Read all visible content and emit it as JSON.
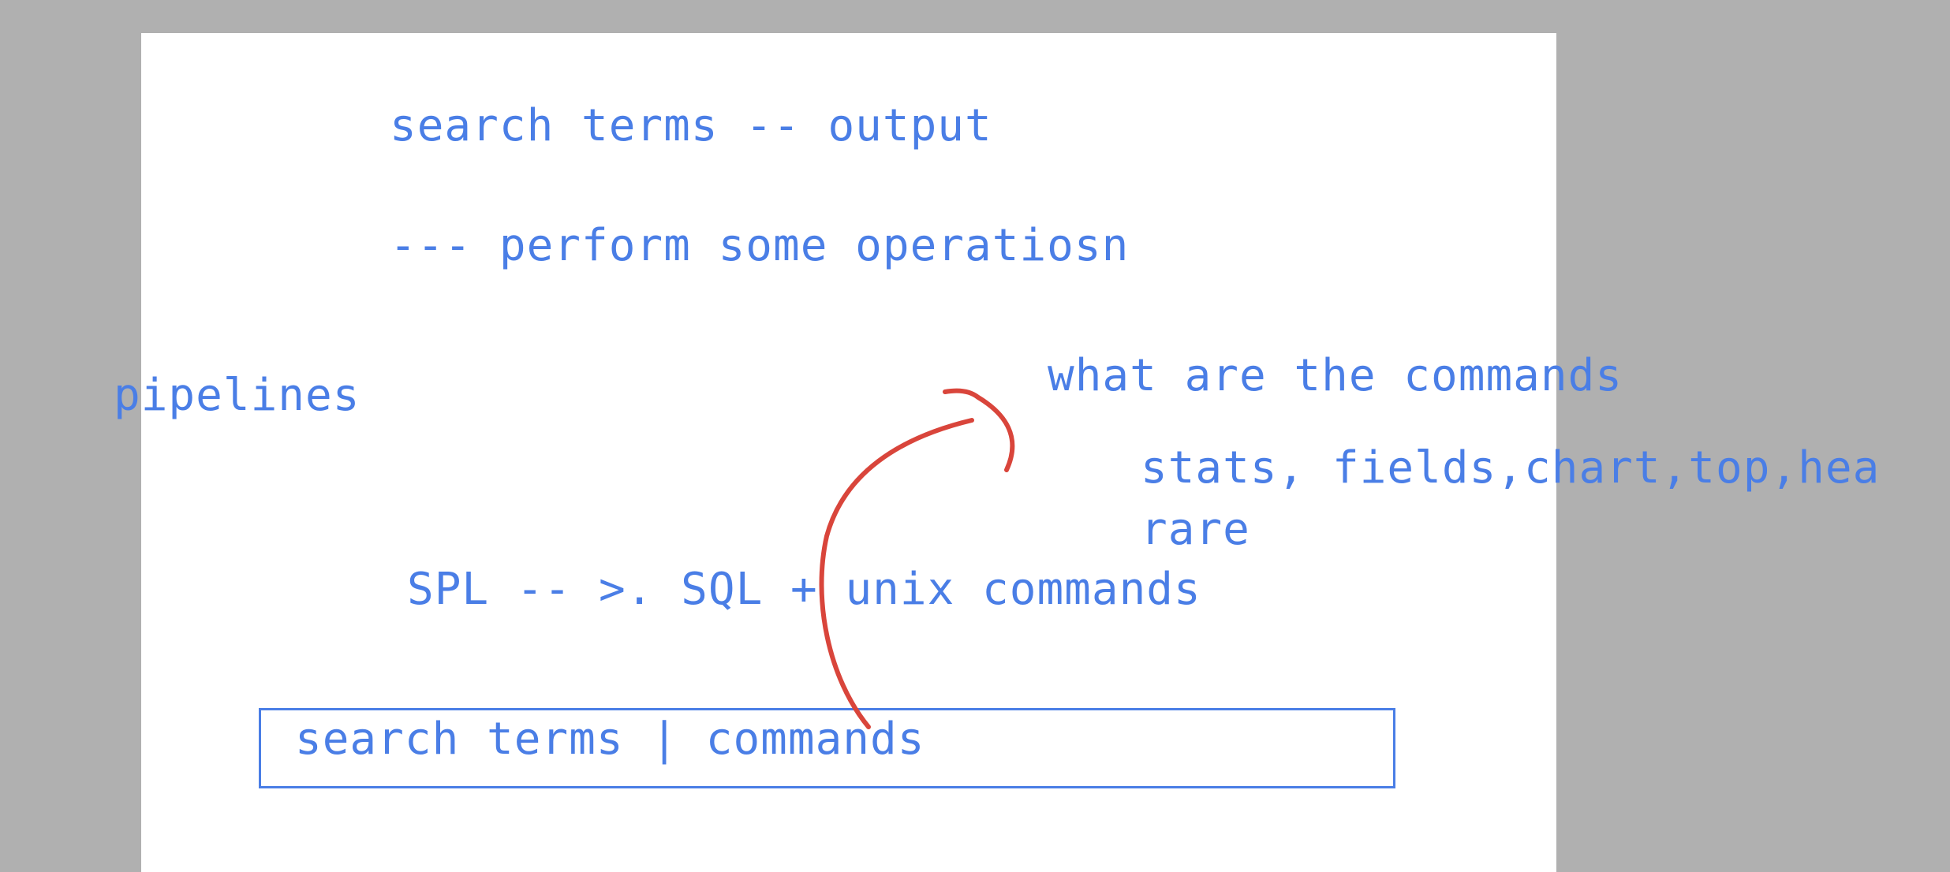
{
  "slide": {
    "line_search_output": "search terms -- output",
    "line_operations": "--- perform some operatiosn",
    "label_pipelines": "pipelines",
    "question_commands": "what are the commands",
    "commands_list": "stats, fields,chart,top,hea",
    "commands_list_2": "rare",
    "line_spl": "SPL -- >. SQL + unix commands",
    "box_text": "search terms | commands"
  },
  "colors": {
    "text": "#4a7ee6",
    "annotation": "#d9453b",
    "background": "#b0b0b0",
    "slide": "#ffffff"
  }
}
